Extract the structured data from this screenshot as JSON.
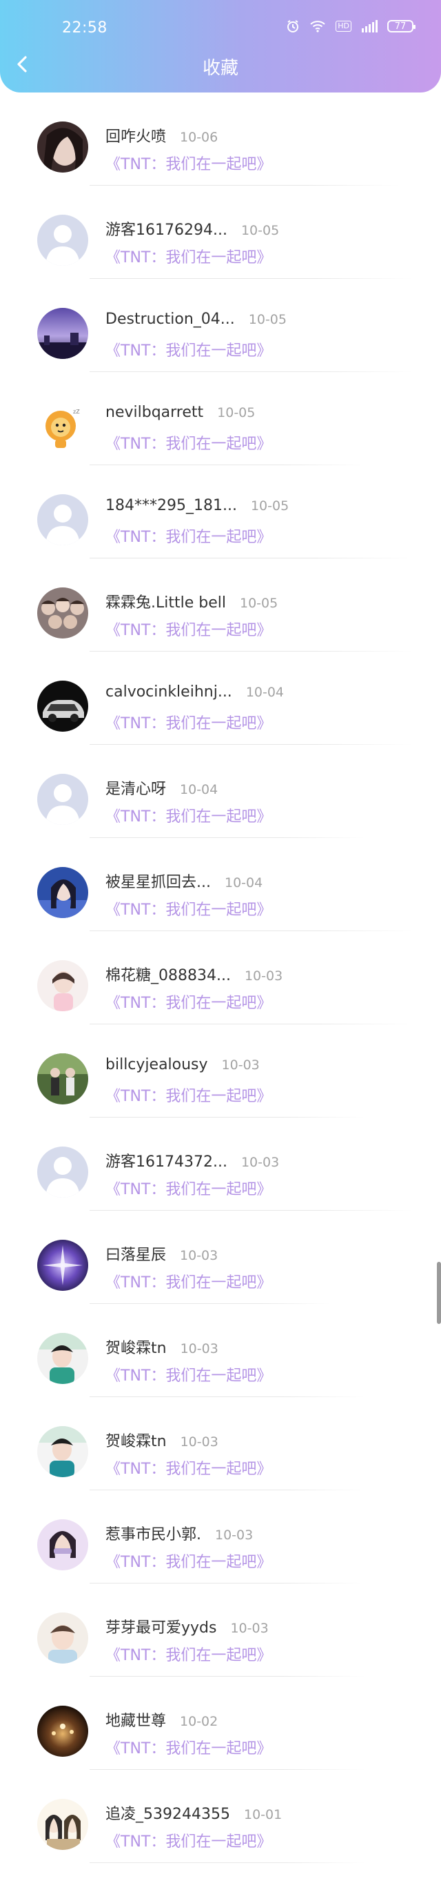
{
  "status_bar": {
    "time": "22:58",
    "hd": "HD",
    "battery": "77",
    "icons": [
      "alarm-icon",
      "wifi-icon",
      "signal-icon",
      "battery-icon"
    ]
  },
  "header": {
    "title": "收藏",
    "back_icon": "chevron-left-icon"
  },
  "colors": {
    "header_gradient_start": "#6fd0f4",
    "header_gradient_end": "#c79cec",
    "link": "#b595e6",
    "name": "#333333",
    "date": "#a3a3a3"
  },
  "items": [
    {
      "name": "回咋火喷",
      "date": "10-06",
      "movie": "《TNT：我们在一起吧》"
    },
    {
      "name": "游客16176294...",
      "date": "10-05",
      "movie": "《TNT：我们在一起吧》"
    },
    {
      "name": "Destruction_04...",
      "date": "10-05",
      "movie": "《TNT：我们在一起吧》"
    },
    {
      "name": "nevilbqarrett",
      "date": "10-05",
      "movie": "《TNT：我们在一起吧》"
    },
    {
      "name": "184***295_181...",
      "date": "10-05",
      "movie": "《TNT：我们在一起吧》"
    },
    {
      "name": "霖霖兔.Little bell",
      "date": "10-05",
      "movie": "《TNT：我们在一起吧》"
    },
    {
      "name": "calvocinkleihnj...",
      "date": "10-04",
      "movie": "《TNT：我们在一起吧》"
    },
    {
      "name": "是清心呀",
      "date": "10-04",
      "movie": "《TNT：我们在一起吧》"
    },
    {
      "name": "被星星抓回去...",
      "date": "10-04",
      "movie": "《TNT：我们在一起吧》"
    },
    {
      "name": "棉花糖_088834...",
      "date": "10-03",
      "movie": "《TNT：我们在一起吧》"
    },
    {
      "name": "billcyjealousy",
      "date": "10-03",
      "movie": "《TNT：我们在一起吧》"
    },
    {
      "name": "游客16174372...",
      "date": "10-03",
      "movie": "《TNT：我们在一起吧》"
    },
    {
      "name": "曰落星辰",
      "date": "10-03",
      "movie": "《TNT：我们在一起吧》"
    },
    {
      "name": "贺峻霖tn",
      "date": "10-03",
      "movie": "《TNT：我们在一起吧》"
    },
    {
      "name": "贺峻霖tn",
      "date": "10-03",
      "movie": "《TNT：我们在一起吧》"
    },
    {
      "name": "惹事市民小郭.",
      "date": "10-03",
      "movie": "《TNT：我们在一起吧》"
    },
    {
      "name": "芽芽最可爱yyds",
      "date": "10-03",
      "movie": "《TNT：我们在一起吧》"
    },
    {
      "name": "地藏世尊",
      "date": "10-02",
      "movie": "《TNT：我们在一起吧》"
    },
    {
      "name": "追凌_539244355",
      "date": "10-01",
      "movie": "《TNT：我们在一起吧》"
    }
  ]
}
